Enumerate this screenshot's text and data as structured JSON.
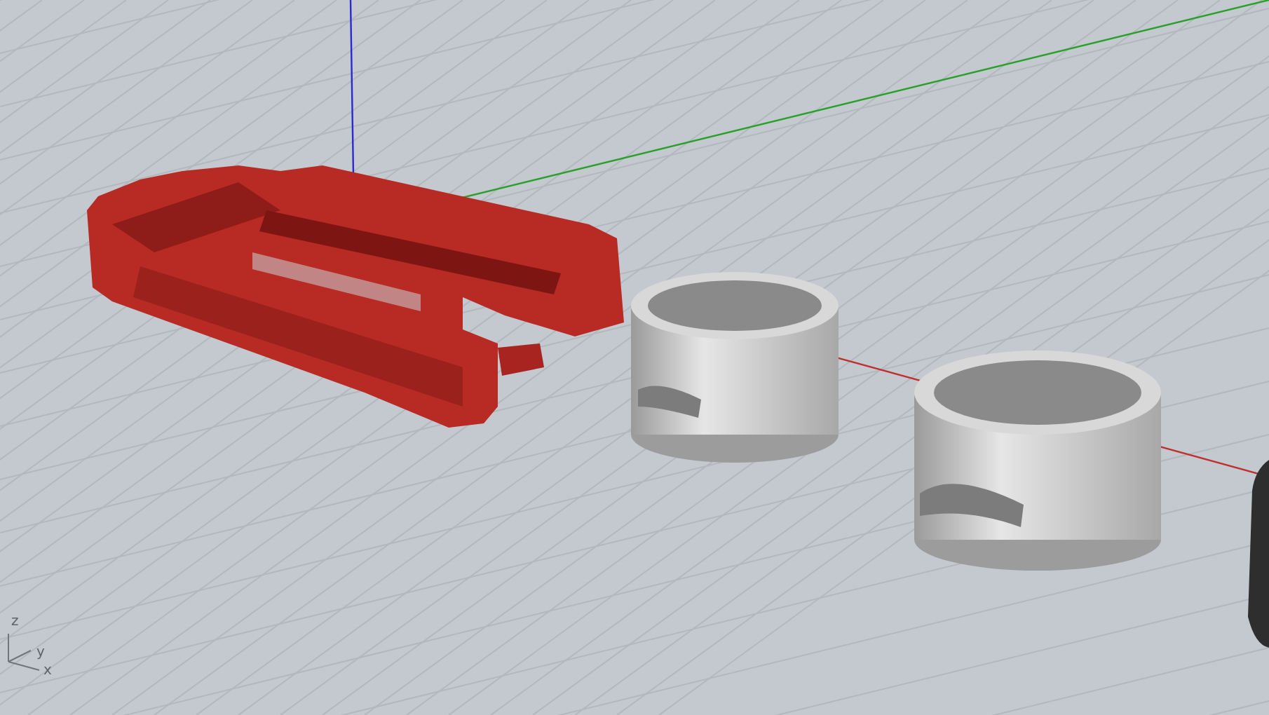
{
  "viewport": {
    "axis_labels": [
      "z",
      "y",
      "x"
    ]
  }
}
